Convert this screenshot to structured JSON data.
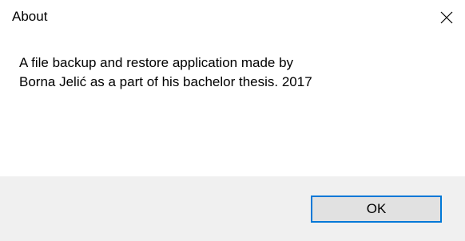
{
  "window": {
    "title": "About",
    "close_icon": "close-icon"
  },
  "message": {
    "line1": "A file backup and restore application made by",
    "line2": "Borna Jelić as a part of his bachelor thesis. 2017"
  },
  "buttons": {
    "ok_label": "OK"
  },
  "colors": {
    "footer_background": "#f0f0f0",
    "button_background": "#e1e1e1",
    "button_focus_border": "#0078d7"
  }
}
